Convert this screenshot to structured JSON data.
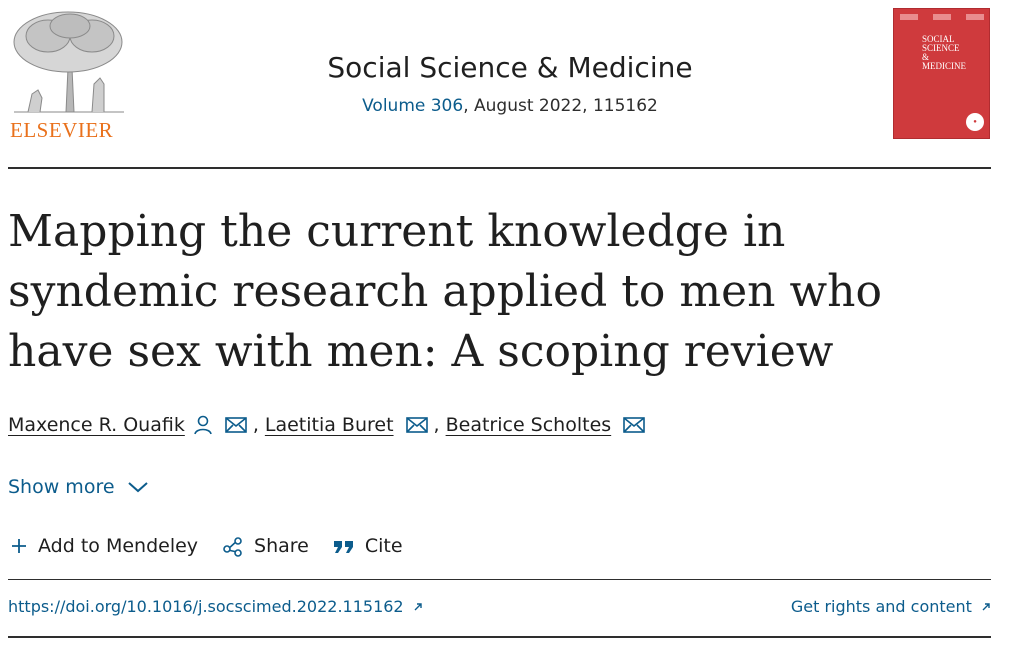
{
  "publisher": {
    "name": "ELSEVIER",
    "logo_icon": "elsevier-tree-logo"
  },
  "journal": {
    "title": "Social Science & Medicine",
    "volume_link": "Volume 306",
    "issue_rest": ", August 2022, 115162",
    "cover_text": "SOCIAL SCIENCE & MEDICINE",
    "cover_color": "#cf3a3d"
  },
  "article": {
    "title": "Mapping the current knowledge in syndemic research applied to men who have sex with men: A scoping review"
  },
  "authors": [
    {
      "name": "Maxence R. Ouafik",
      "has_person_icon": true,
      "has_email_icon": true
    },
    {
      "name": "Laetitia Buret",
      "has_person_icon": false,
      "has_email_icon": true
    },
    {
      "name": "Beatrice Scholtes",
      "has_person_icon": false,
      "has_email_icon": true
    }
  ],
  "author_separator": ",",
  "show_more": {
    "label": "Show more"
  },
  "actions": {
    "mendeley": "Add to Mendeley",
    "share": "Share",
    "cite": "Cite"
  },
  "links": {
    "doi": "https://doi.org/10.1016/j.socscimed.2022.115162",
    "rights": "Get rights and content"
  },
  "colors": {
    "link": "#0c5c8c",
    "publisher": "#e9711c",
    "text": "#1f1f1f"
  }
}
